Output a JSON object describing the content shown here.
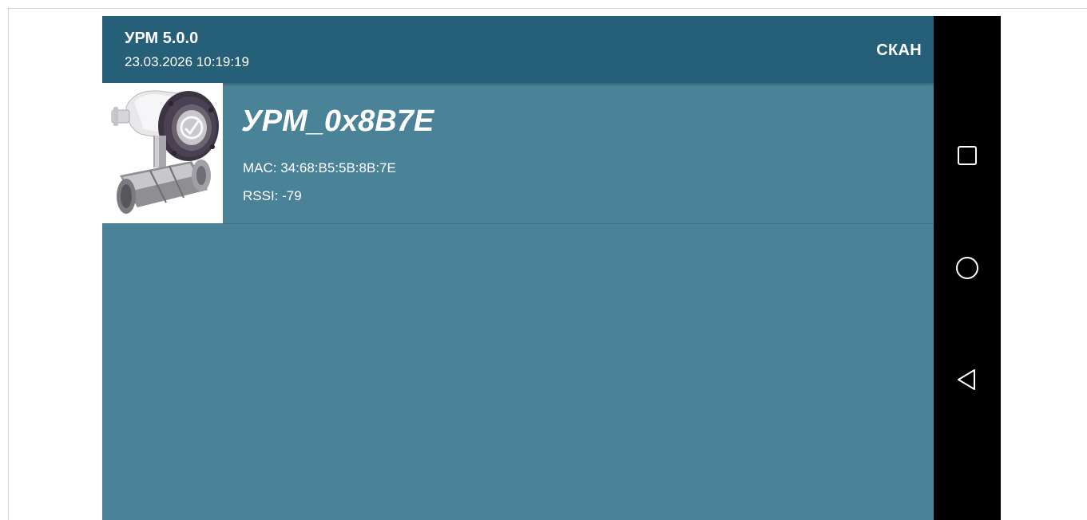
{
  "app_bar": {
    "title": "УРМ 5.0.0",
    "subtitle": "23.03.2026 10:19:19",
    "scan_label": "СКАН"
  },
  "device_list": [
    {
      "name": "УРМ_0x8B7E",
      "mac_label": "MAC:",
      "mac": "34:68:B5:5B:8B:7E",
      "rssi_label": "RSSI:",
      "rssi": "-79",
      "thumbnail_icon": "flowmeter-device-image"
    }
  ],
  "nav_bar": {
    "icons": [
      "recents-square-icon",
      "home-circle-icon",
      "back-triangle-icon"
    ]
  },
  "colors": {
    "app_bar": "#265f78",
    "content_background": "#4a8298",
    "nav_bar": "#000000",
    "text": "#ffffff"
  }
}
